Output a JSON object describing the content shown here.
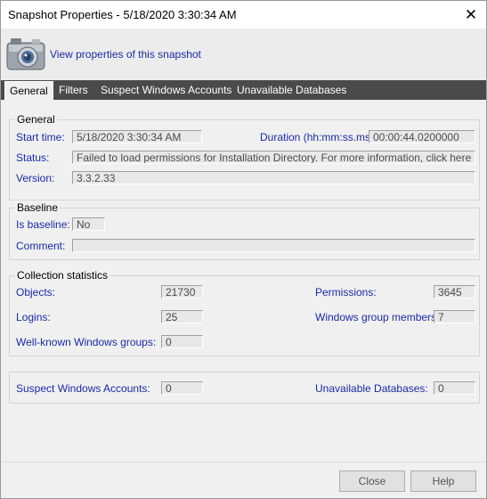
{
  "window": {
    "title": "Snapshot Properties - 5/18/2020 3:30:34 AM",
    "close_glyph": "✕"
  },
  "header": {
    "icon": "camera-icon",
    "link": "View properties of this snapshot"
  },
  "tabs": [
    {
      "label": "General",
      "active": true
    },
    {
      "label": "Filters",
      "active": false
    },
    {
      "label": "Suspect Windows Accounts",
      "active": false
    },
    {
      "label": "Unavailable Databases",
      "active": false
    }
  ],
  "general": {
    "legend": "General",
    "start_time_label": "Start time:",
    "start_time": "5/18/2020 3:30:34 AM",
    "duration_label": "Duration (hh:mm:ss.ms):",
    "duration": "00:00:44.0200000",
    "status_label": "Status:",
    "status": "Failed to load permissions for Installation Directory. For more information, click here http://wi...",
    "version_label": "Version:",
    "version": "3.3.2.33"
  },
  "baseline": {
    "legend": "Baseline",
    "is_baseline_label": "Is baseline:",
    "is_baseline": "No",
    "comment_label": "Comment:",
    "comment": ""
  },
  "stats": {
    "legend": "Collection statistics",
    "objects_label": "Objects:",
    "objects": "21730",
    "permissions_label": "Permissions:",
    "permissions": "3645",
    "logins_label": "Logins:",
    "logins": "25",
    "wgm_label": "Windows group members:",
    "wgm": "7",
    "wkwg_label": "Well-known Windows groups:",
    "wkwg": "0"
  },
  "suspect": {
    "suspect_label": "Suspect Windows Accounts:",
    "suspect": "0",
    "unavailable_label": "Unavailable Databases:",
    "unavailable": "0"
  },
  "footer": {
    "close_label": "Close",
    "help_label": "Help"
  },
  "colors": {
    "link": "#1a2aa8",
    "tabstrip": "#4a4a4a"
  }
}
